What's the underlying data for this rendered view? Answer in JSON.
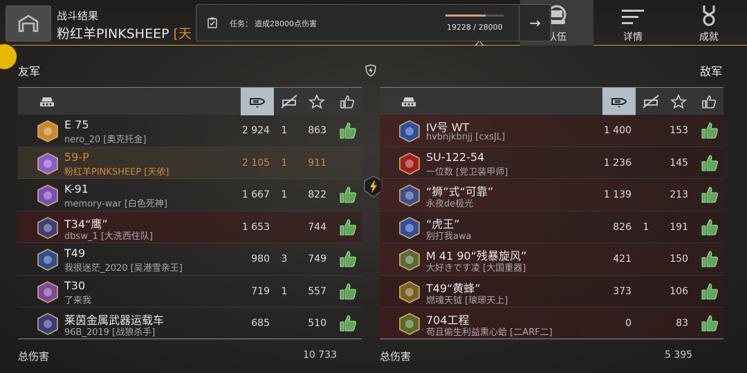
{
  "header": {
    "section_title": "战斗结果",
    "player_name": "粉红羊PINKSHEEP",
    "player_clan_partial": "[天",
    "garage_icon": "garage-icon"
  },
  "task": {
    "label": "任务：",
    "text": "造成28000点伤害",
    "progress_text": "19228 / 28000",
    "progress_fraction": 0.687,
    "arrow": "→"
  },
  "nav": {
    "team_label": "队伍",
    "details_label": "详情",
    "achievements_label": "成就",
    "partial_label": "人"
  },
  "allies": {
    "title": "友军",
    "rows": [
      {
        "tank": "E 75",
        "player": "nero_20 [奥克托金]",
        "damage": "2 924",
        "kills": "1",
        "score": "863",
        "liked": true,
        "badge_color": "#c8892e"
      },
      {
        "tank": "59-P",
        "player": "粉红羊PINKSHEEP [天依]",
        "damage": "2 105",
        "kills": "1",
        "score": "911",
        "liked": false,
        "badge_color": "#8a5bd0"
      },
      {
        "tank": "K-91",
        "player": "memory-war [白色死神]",
        "damage": "1 667",
        "kills": "1",
        "score": "822",
        "liked": true,
        "badge_color": "#7a4fb8"
      },
      {
        "tank": "T34“鹰”",
        "player": "dbsw_1 [大洗西住队]",
        "damage": "1 653",
        "kills": "",
        "score": "744",
        "liked": true,
        "badge_color": "#3b3f7a"
      },
      {
        "tank": "T49",
        "player": "我很迷茫_2020 [吴港雪亲王]",
        "damage": "980",
        "kills": "3",
        "score": "749",
        "liked": true,
        "badge_color": "#2f4e8e"
      },
      {
        "tank": "T30",
        "player": "了来我",
        "damage": "719",
        "kills": "1",
        "score": "557",
        "liked": true,
        "badge_color": "#7b4a9a"
      },
      {
        "tank": "莱茵金属武器运载车",
        "player": "96B_2019 [战狼杀手]",
        "damage": "685",
        "kills": "",
        "score": "510",
        "liked": true,
        "badge_color": "#3a3a7e"
      }
    ],
    "total_label": "总伤害",
    "total_value": "10 733"
  },
  "enemies": {
    "title": "敌军",
    "rows": [
      {
        "tank": "IV号 WT",
        "player": "hvbnjkbnjj [cxsJL]",
        "damage": "1 400",
        "kills": "",
        "score": "153",
        "liked": true,
        "badge_color": "#2d4fa0"
      },
      {
        "tank": "SU-122-54",
        "player": "一位数 [党卫装甲师]",
        "damage": "1 236",
        "kills": "",
        "score": "145",
        "liked": true,
        "badge_color": "#a02020"
      },
      {
        "tank": "“狮”式“可靠”",
        "player": "永夜de极光",
        "damage": "1 139",
        "kills": "",
        "score": "213",
        "liked": true,
        "badge_color": "#3c4f8c"
      },
      {
        "tank": "“虎王”",
        "player": "别打我awa",
        "damage": "826",
        "kills": "1",
        "score": "191",
        "liked": true,
        "badge_color": "#2e4f9a"
      },
      {
        "tank": "M 41 90“残暴旋风”",
        "player": "大好きです凌 [大国重器]",
        "damage": "421",
        "kills": "",
        "score": "150",
        "liked": true,
        "badge_color": "#5a6a3a"
      },
      {
        "tank": "T49“黄蜂”",
        "player": "燃魂天钺 [琅琊天上]",
        "damage": "373",
        "kills": "",
        "score": "106",
        "liked": true,
        "badge_color": "#7a6020"
      },
      {
        "tank": "704工程",
        "player": "苟且偷生利益熏心蛤 [二ARF二]",
        "damage": "0",
        "kills": "",
        "score": "83",
        "liked": true,
        "badge_color": "#5a6a2a"
      }
    ],
    "total_label": "总伤害",
    "total_value": "5 395"
  },
  "colors": {
    "accent_gold": "#c79a3c",
    "highlight_orange": "#cf8a36",
    "like_green": "#5fa85a",
    "active_header": "#b3bdc6"
  }
}
